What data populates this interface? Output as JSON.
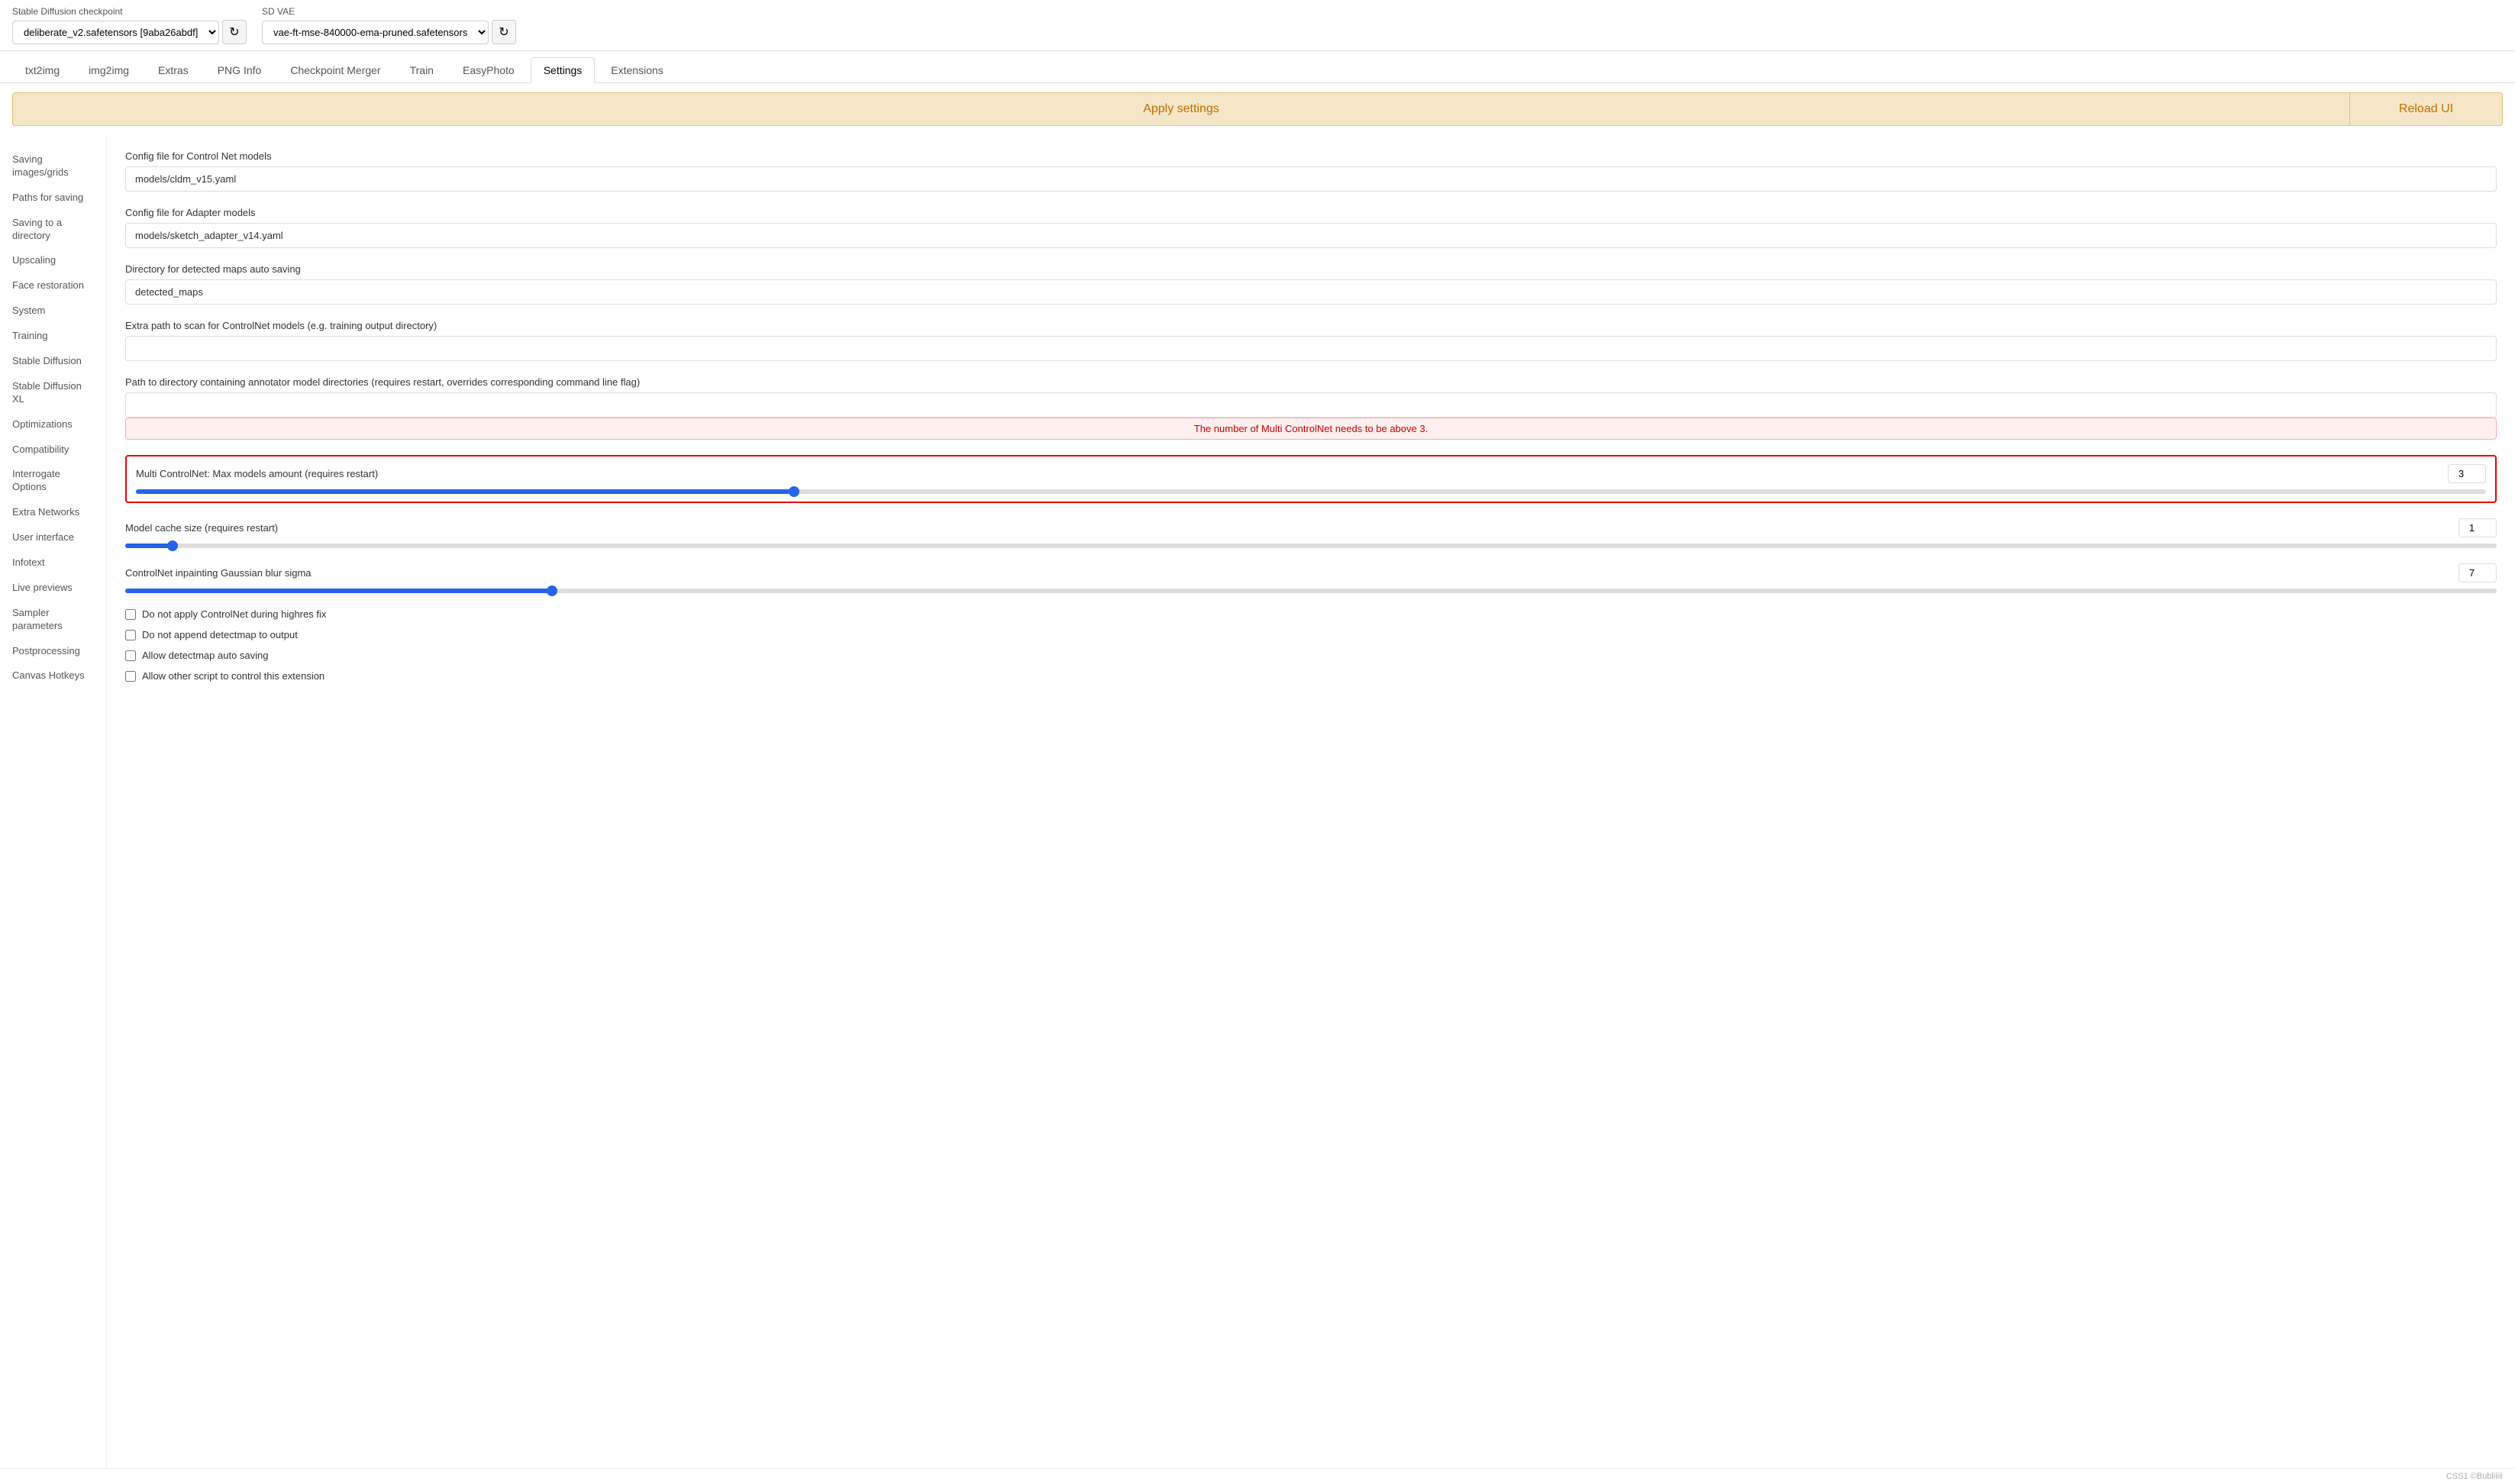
{
  "topbar": {
    "checkpoint_label": "Stable Diffusion checkpoint",
    "checkpoint_value": "deliberate_v2.safetensors [9aba26abdf]",
    "vae_label": "SD VAE",
    "vae_value": "vae-ft-mse-840000-ema-pruned.safetensors",
    "refresh_icon": "↻"
  },
  "tabs": [
    {
      "id": "txt2img",
      "label": "txt2img"
    },
    {
      "id": "img2img",
      "label": "img2img"
    },
    {
      "id": "extras",
      "label": "Extras"
    },
    {
      "id": "png_info",
      "label": "PNG Info"
    },
    {
      "id": "checkpoint_merger",
      "label": "Checkpoint Merger"
    },
    {
      "id": "train",
      "label": "Train"
    },
    {
      "id": "easyphoto",
      "label": "EasyPhoto"
    },
    {
      "id": "settings",
      "label": "Settings",
      "active": true
    },
    {
      "id": "extensions",
      "label": "Extensions"
    }
  ],
  "actions": {
    "apply_label": "Apply settings",
    "reload_label": "Reload UI"
  },
  "sidebar": [
    {
      "id": "saving_images",
      "label": "Saving images/grids"
    },
    {
      "id": "paths_saving",
      "label": "Paths for saving"
    },
    {
      "id": "saving_directory",
      "label": "Saving to a directory"
    },
    {
      "id": "upscaling",
      "label": "Upscaling"
    },
    {
      "id": "face_restoration",
      "label": "Face restoration"
    },
    {
      "id": "system",
      "label": "System"
    },
    {
      "id": "training",
      "label": "Training"
    },
    {
      "id": "stable_diffusion",
      "label": "Stable Diffusion"
    },
    {
      "id": "stable_diffusion_xl",
      "label": "Stable Diffusion XL"
    },
    {
      "id": "optimizations",
      "label": "Optimizations"
    },
    {
      "id": "compatibility",
      "label": "Compatibility"
    },
    {
      "id": "interrogate",
      "label": "Interrogate Options"
    },
    {
      "id": "extra_networks",
      "label": "Extra Networks"
    },
    {
      "id": "user_interface",
      "label": "User interface"
    },
    {
      "id": "infotext",
      "label": "Infotext"
    },
    {
      "id": "live_previews",
      "label": "Live previews"
    },
    {
      "id": "sampler_params",
      "label": "Sampler parameters"
    },
    {
      "id": "postprocessing",
      "label": "Postprocessing"
    },
    {
      "id": "canvas_hotkeys",
      "label": "Canvas Hotkeys"
    }
  ],
  "settings": {
    "controlnet_config_label": "Config file for Control Net models",
    "controlnet_config_value": "models/cldm_v15.yaml",
    "adapter_config_label": "Config file for Adapter models",
    "adapter_config_value": "models/sketch_adapter_v14.yaml",
    "detected_maps_label": "Directory for detected maps auto saving",
    "detected_maps_value": "detected_maps",
    "extra_path_label": "Extra path to scan for ControlNet models (e.g. training output directory)",
    "extra_path_value": "",
    "annotator_path_label": "Path to directory containing annotator model directories (requires restart, overrides corresponding command line flag)",
    "annotator_path_value": "",
    "error_message": "The number of Multi ControlNet needs to be above 3.",
    "multi_controlnet_label": "Multi ControlNet: Max models amount (requires restart)",
    "multi_controlnet_value": "3",
    "multi_controlnet_fill_pct": 28,
    "multi_controlnet_thumb_pct": 28,
    "model_cache_label": "Model cache size (requires restart)",
    "model_cache_value": "1",
    "model_cache_fill_pct": 2,
    "model_cache_thumb_pct": 2,
    "gaussian_blur_label": "ControlNet inpainting Gaussian blur sigma",
    "gaussian_blur_value": "7",
    "gaussian_blur_fill_pct": 18,
    "gaussian_blur_thumb_pct": 18,
    "checkboxes": [
      {
        "id": "no_highres",
        "label": "Do not apply ControlNet during highres fix",
        "checked": false
      },
      {
        "id": "no_detectmap",
        "label": "Do not append detectmap to output",
        "checked": false
      },
      {
        "id": "auto_saving",
        "label": "Allow detectmap auto saving",
        "checked": false
      },
      {
        "id": "allow_script",
        "label": "Allow other script to control this extension",
        "checked": false
      }
    ]
  },
  "footer": {
    "text": "CSS1 ©Bubliiiii"
  }
}
